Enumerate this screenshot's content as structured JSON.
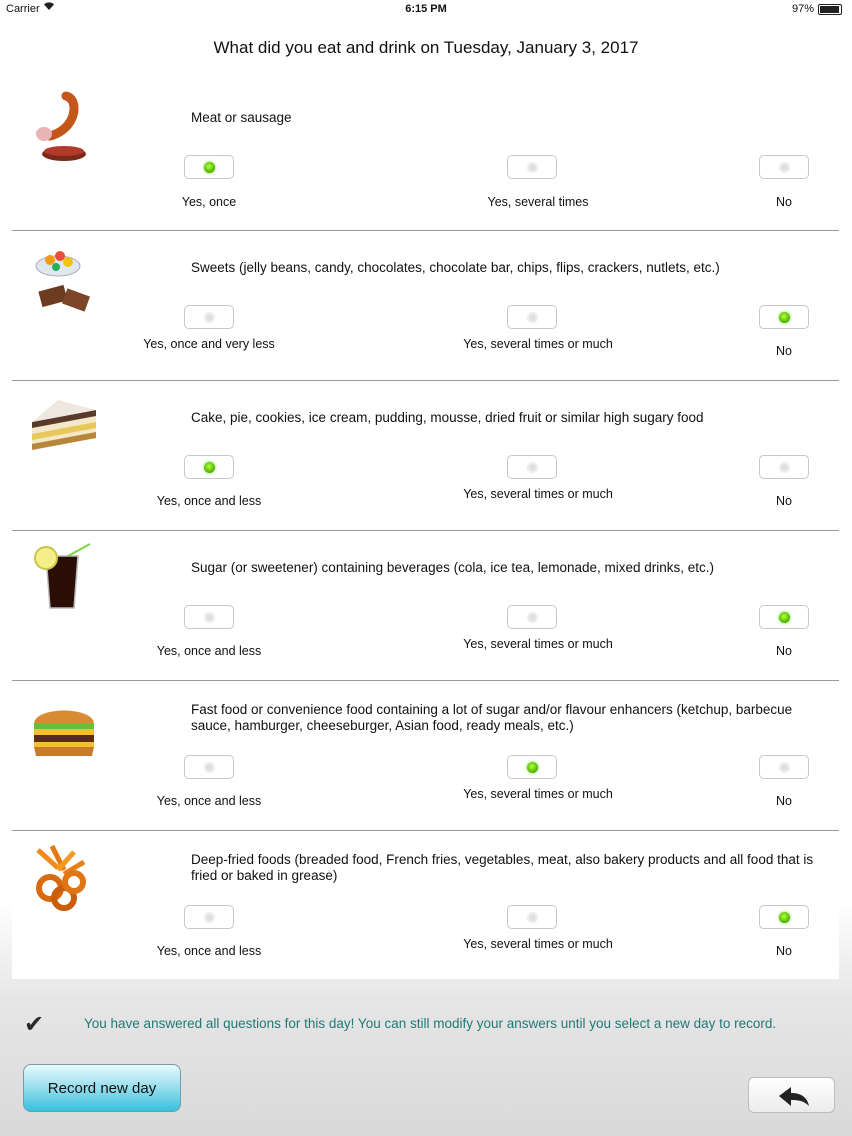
{
  "status_bar": {
    "carrier": "Carrier",
    "time": "6:15 PM",
    "battery": "97%"
  },
  "header": {
    "title": "What did you eat and drink on Tuesday, January 3, 2017"
  },
  "questions": [
    {
      "text": "Meat or sausage",
      "icon": "meat-sausage-icon",
      "options": [
        "Yes, once",
        "Yes, several times",
        "No"
      ],
      "selected": 0
    },
    {
      "text": "Sweets (jelly beans, candy, chocolates, chocolate bar, chips, flips, crackers, nutlets, etc.)",
      "icon": "sweets-icon",
      "options": [
        "Yes, once and very less",
        "Yes, several times or much",
        "No"
      ],
      "selected": 2
    },
    {
      "text": "Cake, pie, cookies, ice cream, pudding, mousse, dried fruit or similar high sugary food",
      "icon": "cake-icon",
      "options": [
        "Yes, once and less",
        "Yes, several times or much",
        "No"
      ],
      "selected": 0
    },
    {
      "text": "Sugar (or sweetener) containing beverages (cola, ice tea, lemonade, mixed drinks, etc.)",
      "icon": "cola-drink-icon",
      "options": [
        "Yes, once and less",
        "Yes, several times or much",
        "No"
      ],
      "selected": 2
    },
    {
      "text": "Fast food or convenience food containing a lot of sugar and/or flavour enhancers (ketchup, barbecue sauce, hamburger, cheeseburger, Asian food, ready meals, etc.)",
      "icon": "hamburger-icon",
      "options": [
        "Yes, once and less",
        "Yes, several times or much",
        "No"
      ],
      "selected": 1
    },
    {
      "text": "Deep-fried foods (breaded food, French fries, vegetables, meat, also bakery products and all food that is fried or baked in grease)",
      "icon": "fried-food-icon",
      "options": [
        "Yes, once and less",
        "Yes, several times or much",
        "No"
      ],
      "selected": 2
    }
  ],
  "footer": {
    "message": "You have answered all questions for this day! You can still modify your answers until you select a new day to record.",
    "record_button": "Record new day",
    "check_icon": "checkmark-icon",
    "back_icon": "back-arrow-icon"
  },
  "colors": {
    "accent_message": "#1f7a76",
    "radio_on": "#5cc10d",
    "button": "#38c1dc"
  }
}
